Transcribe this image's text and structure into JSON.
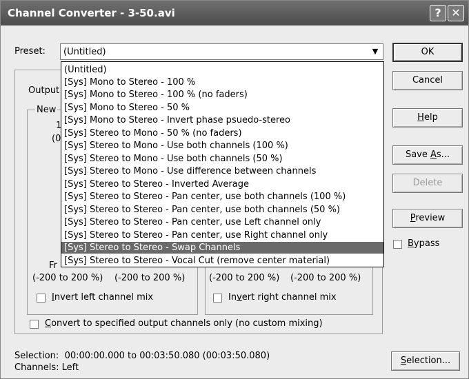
{
  "window": {
    "title": "Channel Converter - 3-50.avi",
    "help_glyph": "?",
    "close_glyph": "✕"
  },
  "preset": {
    "label": "Preset:",
    "value": "(Untitled)",
    "options": [
      "(Untitled)",
      "[Sys] Mono to Stereo - 100 %",
      "[Sys] Mono to Stereo - 100 % (no faders)",
      "[Sys] Mono to Stereo - 50 %",
      "[Sys] Mono to Stereo - Invert phase psuedo-stereo",
      "[Sys] Stereo to Mono - 50 % (no faders)",
      "[Sys] Stereo to Mono - Use both channels (100 %)",
      "[Sys] Stereo to Mono - Use both channels (50 %)",
      "[Sys] Stereo to Mono - Use difference between channels",
      "[Sys] Stereo to Stereo - Inverted Average",
      "[Sys] Stereo to Stereo - Pan center, use both channels (100 %)",
      "[Sys] Stereo to Stereo - Pan center, use both channels (50 %)",
      "[Sys] Stereo to Stereo - Pan center, use Left channel only",
      "[Sys] Stereo to Stereo - Pan center, use Right channel only",
      "[Sys] Stereo to Stereo - Swap Channels",
      "[Sys] Stereo to Stereo - Vocal Cut (remove center material)"
    ],
    "highlighted_index": 14
  },
  "buttons": {
    "ok": "OK",
    "cancel": "Cancel",
    "help_pre": "",
    "help_ul": "H",
    "help_post": "elp",
    "saveas_pre": "Save ",
    "saveas_ul": "A",
    "saveas_post": "s...",
    "delete": "Delete",
    "preview_pre": "",
    "preview_ul": "P",
    "preview_post": "review",
    "selection_pre": "",
    "selection_ul": "S",
    "selection_post": "election..."
  },
  "bypass": {
    "pre": "",
    "ul": "B",
    "post": "ypass"
  },
  "behind": {
    "output_fragment": "Output",
    "new_fragment": "New",
    "val1": "1",
    "val2": "(0",
    "fr_fragment": "Fr",
    "left_range1": "(-200 to 200 %)",
    "left_range2": "(-200 to 200 %)",
    "right_range1": "(-200 to 200 %)",
    "right_range2": "(-200 to 200 %)"
  },
  "invert_left": {
    "pre": "",
    "ul": "I",
    "post": "nvert left channel mix"
  },
  "invert_right": {
    "pre": "In",
    "ul": "v",
    "post": "ert right channel mix"
  },
  "convert_only": {
    "pre": "",
    "ul": "C",
    "post": "onvert to specified output channels only (no custom mixing)"
  },
  "status": {
    "selection_label": "Selection:",
    "selection_value": "00:00:00.000 to 00:03:50.080 (00:03:50.080)",
    "channels_label": "Channels:",
    "channels_value": "Left"
  }
}
